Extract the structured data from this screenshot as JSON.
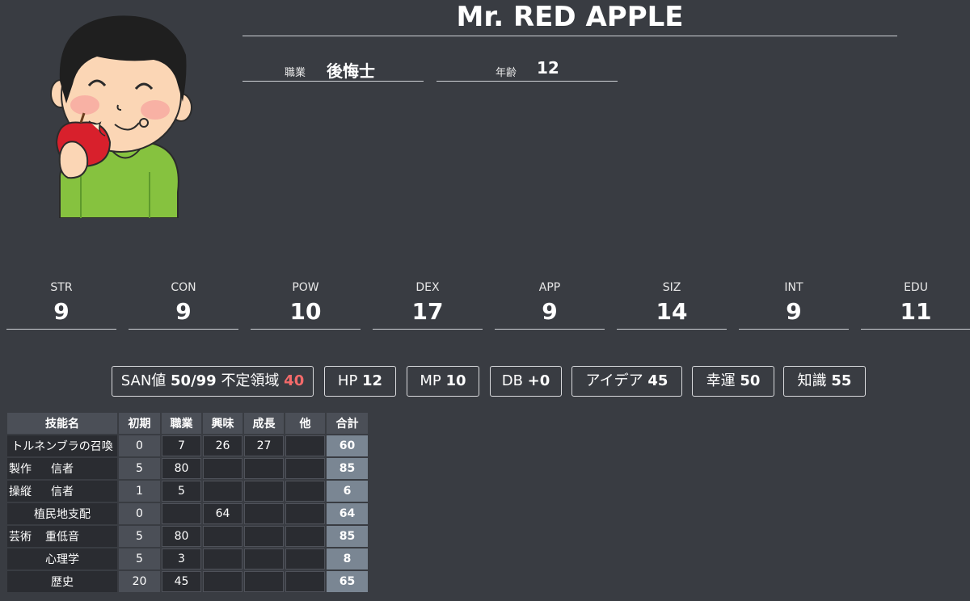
{
  "character": {
    "name": "Mr. RED APPLE",
    "occupation_label": "職業",
    "occupation": "後悔士",
    "age_label": "年齢",
    "age": "12"
  },
  "stats": [
    {
      "label": "STR",
      "value": "9"
    },
    {
      "label": "CON",
      "value": "9"
    },
    {
      "label": "POW",
      "value": "10"
    },
    {
      "label": "DEX",
      "value": "17"
    },
    {
      "label": "APP",
      "value": "9"
    },
    {
      "label": "SIZ",
      "value": "14"
    },
    {
      "label": "INT",
      "value": "9"
    },
    {
      "label": "EDU",
      "value": "11"
    }
  ],
  "derived": {
    "san_label": "SAN値",
    "san_value": "50/99",
    "indef_label": "不定領域",
    "indef_value": "40",
    "hp_label": "HP",
    "hp_value": "12",
    "mp_label": "MP",
    "mp_value": "10",
    "db_label": "DB",
    "db_value": "+0",
    "idea_label": "アイデア",
    "idea_value": "45",
    "luck_label": "幸運",
    "luck_value": "50",
    "know_label": "知識",
    "know_value": "55"
  },
  "skills": {
    "headers": [
      "技能名",
      "初期",
      "職業",
      "興味",
      "成長",
      "他",
      "合計"
    ],
    "rows": [
      {
        "category": "",
        "name": "トルネンブラの召喚",
        "init": "0",
        "job": "7",
        "interest": "26",
        "growth": "27",
        "other": "",
        "total": "60"
      },
      {
        "category": "製作",
        "name": "信者",
        "init": "5",
        "job": "80",
        "interest": "",
        "growth": "",
        "other": "",
        "total": "85"
      },
      {
        "category": "操縦",
        "name": "信者",
        "init": "1",
        "job": "5",
        "interest": "",
        "growth": "",
        "other": "",
        "total": "6"
      },
      {
        "category": "",
        "name": "植民地支配",
        "init": "0",
        "job": "",
        "interest": "64",
        "growth": "",
        "other": "",
        "total": "64"
      },
      {
        "category": "芸術",
        "name": "重低音",
        "init": "5",
        "job": "80",
        "interest": "",
        "growth": "",
        "other": "",
        "total": "85"
      },
      {
        "category": "",
        "name": "心理学",
        "init": "5",
        "job": "3",
        "interest": "",
        "growth": "",
        "other": "",
        "total": "8"
      },
      {
        "category": "",
        "name": "歴史",
        "init": "20",
        "job": "45",
        "interest": "",
        "growth": "",
        "other": "",
        "total": "65"
      }
    ]
  }
}
